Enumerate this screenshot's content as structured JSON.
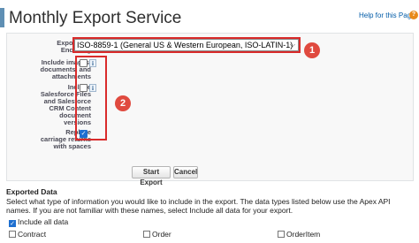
{
  "header": {
    "title": "Monthly Export Service",
    "help_link": "Help for this Page",
    "help_icon": "?"
  },
  "form": {
    "encoding": {
      "label": "Export File Encoding",
      "value": "ISO-8859-1 (General US & Western European, ISO-LATIN-1)",
      "arrow": "⌵"
    },
    "include_images": {
      "label": "Include images, documents, and attachments",
      "checked": false
    },
    "include_salesforce_files": {
      "label": "Include Salesforce Files and Salesforce CRM Content document versions",
      "checked": false
    },
    "replace_carriage": {
      "label": "Replace carriage returns with spaces",
      "checked": true
    },
    "info_glyph": "i",
    "check_glyph": "✓"
  },
  "annotations": {
    "badge1": "1",
    "badge2": "2",
    "highlight_color": "#d92b2b"
  },
  "buttons": {
    "start_export": "Start Export",
    "cancel": "Cancel"
  },
  "exported_data": {
    "title": "Exported Data",
    "description": "Select what type of information you would like to include in the export. The data types listed below use the Apex API names. If you are not familiar with these names, select Include all data for your export.",
    "include_all": {
      "label": "Include all data",
      "checked": true
    },
    "items": [
      {
        "label": "Contract",
        "checked": false
      },
      {
        "label": "Order",
        "checked": false
      },
      {
        "label": "OrderItem",
        "checked": false
      }
    ]
  }
}
